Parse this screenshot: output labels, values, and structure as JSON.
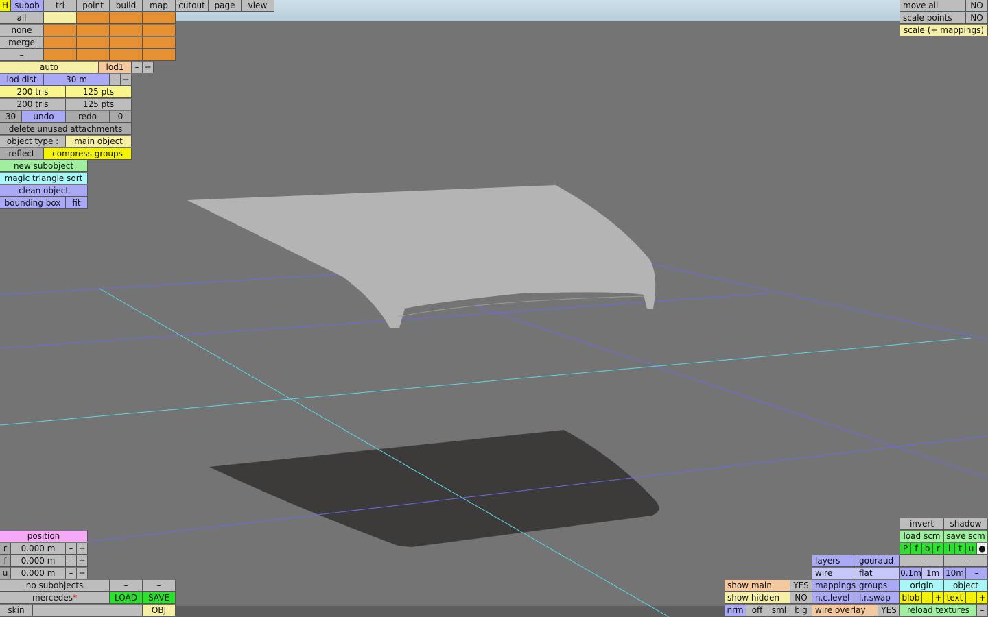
{
  "top_tabs": [
    "H",
    "subob",
    "tri",
    "point",
    "build",
    "map",
    "cutout",
    "page",
    "view"
  ],
  "selection_rows": [
    "all",
    "none",
    "merge",
    "–"
  ],
  "lod": {
    "auto": "auto",
    "lod": "lod1",
    "minus": "–",
    "plus": "+",
    "dist_label": "lod dist",
    "dist_value": "30 m",
    "tris_1": "200 tris",
    "pts_1": "125 pts",
    "tris_2": "200 tris",
    "pts_2": "125 pts"
  },
  "history": {
    "undo_count": "30",
    "undo": "undo",
    "redo": "redo",
    "redo_count": "0"
  },
  "actions": {
    "delete_unused": "delete unused attachments",
    "object_type_label": "object type :",
    "object_type_value": "main object",
    "reflect": "reflect",
    "compress_groups": "compress groups",
    "new_subobject": "new subobject",
    "magic_sort": "magic triangle sort",
    "clean_object": "clean object",
    "bounding_box": "bounding box",
    "fit": "fit"
  },
  "top_right": [
    {
      "label": "move all",
      "value": "NO"
    },
    {
      "label": "scale points",
      "value": "NO"
    },
    {
      "label": "scale (+ mappings)",
      "value": ""
    }
  ],
  "position": {
    "title": "position",
    "rows": [
      {
        "axis": "r",
        "value": "0.000 m",
        "minus": "–",
        "plus": "+"
      },
      {
        "axis": "f",
        "value": "0.000 m",
        "minus": "–",
        "plus": "+"
      },
      {
        "axis": "u",
        "value": "0.000 m",
        "minus": "–",
        "plus": "+"
      }
    ]
  },
  "bottom_left": {
    "no_subobjects": "no subobjects",
    "dash1": "–",
    "dash2": "–",
    "model_name": "mercedes",
    "modified_mark": "*",
    "load": "LOAD",
    "save": "SAVE",
    "skin": "skin",
    "obj": "OBJ"
  },
  "bottom_right": {
    "invert": "invert",
    "shadow": "shadow",
    "load_scm": "load scm",
    "save_scm": "save scm",
    "views": [
      "P",
      "f",
      "b",
      "r",
      "l",
      "t",
      "u",
      "●"
    ],
    "dash_a": "–",
    "dash_b": "–",
    "layers": "layers",
    "gouraud": "gouraud",
    "wire": "wire",
    "flat": "flat",
    "grid_01": "0.1m",
    "grid_1": "1m",
    "grid_10": "10m",
    "grid_minus": "–",
    "show_main": "show main",
    "show_main_val": "YES",
    "mappings": "mappings",
    "groups": "groups",
    "origin": "origin",
    "object": "object",
    "show_hidden": "show hidden",
    "show_hidden_val": "NO",
    "nc_level": "n.c.level",
    "lr_swap": "l.r.swap",
    "blob": "blob",
    "blob_minus": "–",
    "blob_plus": "+",
    "text": "text",
    "text_minus": "–",
    "text_plus": "+",
    "nrm": "nrm",
    "off": "off",
    "sml": "sml",
    "big": "big",
    "wire_overlay": "wire overlay",
    "wire_overlay_val": "YES",
    "reload_textures": "reload textures",
    "last_minus": "–"
  },
  "colors": {
    "background": "#747474",
    "mesh": "#b4b4b4",
    "shadow": "#3d3a3a",
    "grid_blue": "#6a6ae8",
    "grid_cyan": "#5ad8e8"
  }
}
